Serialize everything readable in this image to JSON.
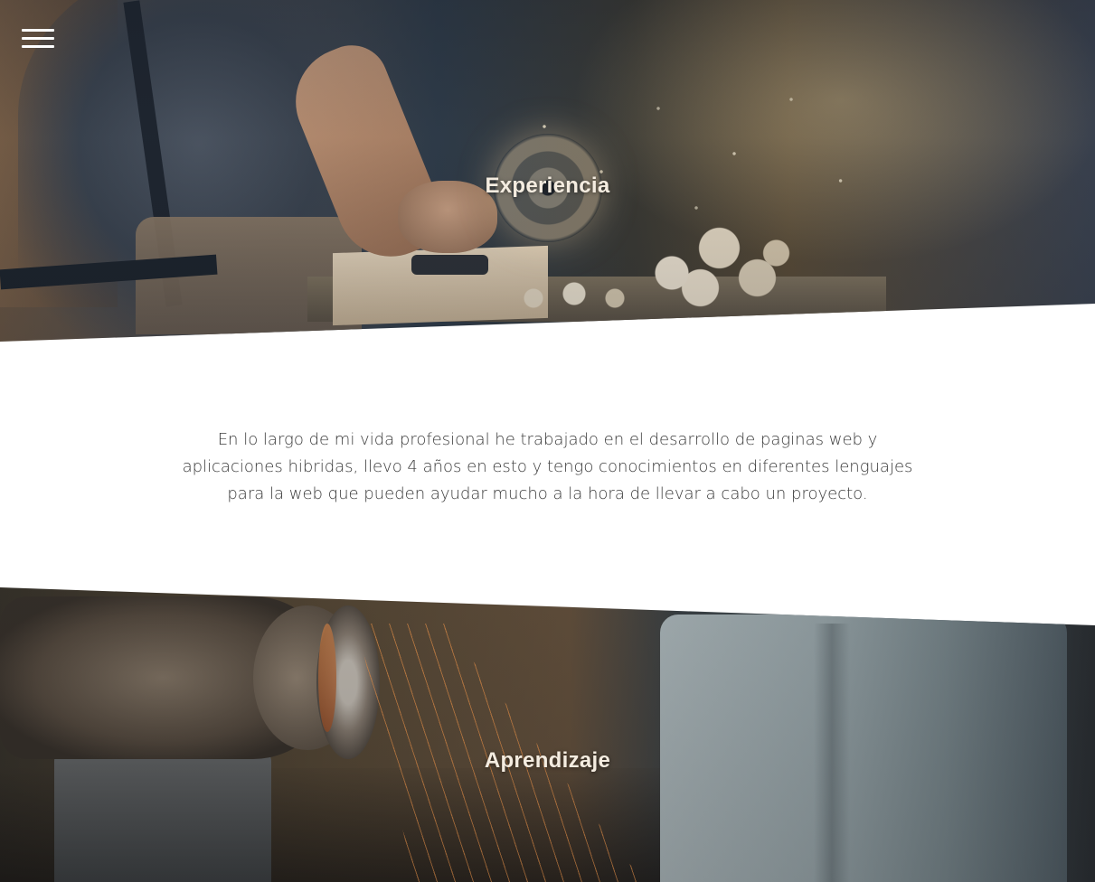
{
  "nav": {
    "menu_icon": "hamburger-menu-icon"
  },
  "sections": {
    "experience": {
      "title": "Experiencia",
      "image": "carpenter-planing-wood"
    },
    "intro": {
      "text": "En lo largo de mi vida profesional he trabajado en el desarrollo de paginas web y aplicaciones hibridas, llevo 4 años en esto y tengo conocimientos en diferentes lenguajes para la web que pueden ayudar mucho a la hora de llevar a cabo un proyecto."
    },
    "learning": {
      "title": "Aprendizaje",
      "image": "grinder-with-sparks"
    }
  },
  "colors": {
    "title_text": "#f4ece0",
    "body_text": "#3b3b3b",
    "background": "#ffffff"
  }
}
